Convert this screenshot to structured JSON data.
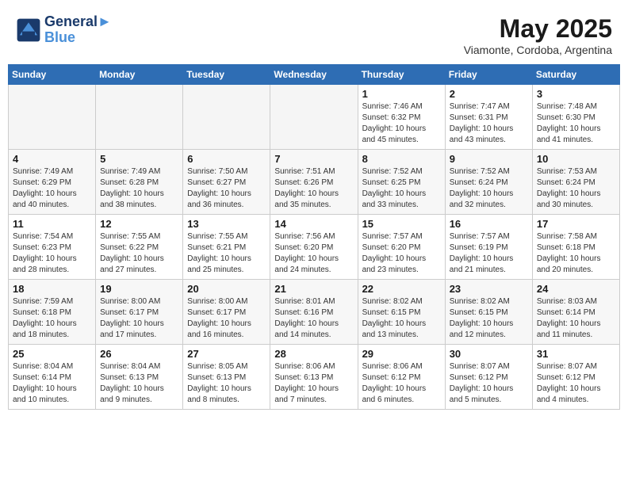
{
  "header": {
    "logo_line1": "General",
    "logo_line2": "Blue",
    "month_year": "May 2025",
    "location": "Viamonte, Cordoba, Argentina"
  },
  "weekdays": [
    "Sunday",
    "Monday",
    "Tuesday",
    "Wednesday",
    "Thursday",
    "Friday",
    "Saturday"
  ],
  "weeks": [
    [
      {
        "day": "",
        "info": ""
      },
      {
        "day": "",
        "info": ""
      },
      {
        "day": "",
        "info": ""
      },
      {
        "day": "",
        "info": ""
      },
      {
        "day": "1",
        "info": "Sunrise: 7:46 AM\nSunset: 6:32 PM\nDaylight: 10 hours\nand 45 minutes."
      },
      {
        "day": "2",
        "info": "Sunrise: 7:47 AM\nSunset: 6:31 PM\nDaylight: 10 hours\nand 43 minutes."
      },
      {
        "day": "3",
        "info": "Sunrise: 7:48 AM\nSunset: 6:30 PM\nDaylight: 10 hours\nand 41 minutes."
      }
    ],
    [
      {
        "day": "4",
        "info": "Sunrise: 7:49 AM\nSunset: 6:29 PM\nDaylight: 10 hours\nand 40 minutes."
      },
      {
        "day": "5",
        "info": "Sunrise: 7:49 AM\nSunset: 6:28 PM\nDaylight: 10 hours\nand 38 minutes."
      },
      {
        "day": "6",
        "info": "Sunrise: 7:50 AM\nSunset: 6:27 PM\nDaylight: 10 hours\nand 36 minutes."
      },
      {
        "day": "7",
        "info": "Sunrise: 7:51 AM\nSunset: 6:26 PM\nDaylight: 10 hours\nand 35 minutes."
      },
      {
        "day": "8",
        "info": "Sunrise: 7:52 AM\nSunset: 6:25 PM\nDaylight: 10 hours\nand 33 minutes."
      },
      {
        "day": "9",
        "info": "Sunrise: 7:52 AM\nSunset: 6:24 PM\nDaylight: 10 hours\nand 32 minutes."
      },
      {
        "day": "10",
        "info": "Sunrise: 7:53 AM\nSunset: 6:24 PM\nDaylight: 10 hours\nand 30 minutes."
      }
    ],
    [
      {
        "day": "11",
        "info": "Sunrise: 7:54 AM\nSunset: 6:23 PM\nDaylight: 10 hours\nand 28 minutes."
      },
      {
        "day": "12",
        "info": "Sunrise: 7:55 AM\nSunset: 6:22 PM\nDaylight: 10 hours\nand 27 minutes."
      },
      {
        "day": "13",
        "info": "Sunrise: 7:55 AM\nSunset: 6:21 PM\nDaylight: 10 hours\nand 25 minutes."
      },
      {
        "day": "14",
        "info": "Sunrise: 7:56 AM\nSunset: 6:20 PM\nDaylight: 10 hours\nand 24 minutes."
      },
      {
        "day": "15",
        "info": "Sunrise: 7:57 AM\nSunset: 6:20 PM\nDaylight: 10 hours\nand 23 minutes."
      },
      {
        "day": "16",
        "info": "Sunrise: 7:57 AM\nSunset: 6:19 PM\nDaylight: 10 hours\nand 21 minutes."
      },
      {
        "day": "17",
        "info": "Sunrise: 7:58 AM\nSunset: 6:18 PM\nDaylight: 10 hours\nand 20 minutes."
      }
    ],
    [
      {
        "day": "18",
        "info": "Sunrise: 7:59 AM\nSunset: 6:18 PM\nDaylight: 10 hours\nand 18 minutes."
      },
      {
        "day": "19",
        "info": "Sunrise: 8:00 AM\nSunset: 6:17 PM\nDaylight: 10 hours\nand 17 minutes."
      },
      {
        "day": "20",
        "info": "Sunrise: 8:00 AM\nSunset: 6:17 PM\nDaylight: 10 hours\nand 16 minutes."
      },
      {
        "day": "21",
        "info": "Sunrise: 8:01 AM\nSunset: 6:16 PM\nDaylight: 10 hours\nand 14 minutes."
      },
      {
        "day": "22",
        "info": "Sunrise: 8:02 AM\nSunset: 6:15 PM\nDaylight: 10 hours\nand 13 minutes."
      },
      {
        "day": "23",
        "info": "Sunrise: 8:02 AM\nSunset: 6:15 PM\nDaylight: 10 hours\nand 12 minutes."
      },
      {
        "day": "24",
        "info": "Sunrise: 8:03 AM\nSunset: 6:14 PM\nDaylight: 10 hours\nand 11 minutes."
      }
    ],
    [
      {
        "day": "25",
        "info": "Sunrise: 8:04 AM\nSunset: 6:14 PM\nDaylight: 10 hours\nand 10 minutes."
      },
      {
        "day": "26",
        "info": "Sunrise: 8:04 AM\nSunset: 6:13 PM\nDaylight: 10 hours\nand 9 minutes."
      },
      {
        "day": "27",
        "info": "Sunrise: 8:05 AM\nSunset: 6:13 PM\nDaylight: 10 hours\nand 8 minutes."
      },
      {
        "day": "28",
        "info": "Sunrise: 8:06 AM\nSunset: 6:13 PM\nDaylight: 10 hours\nand 7 minutes."
      },
      {
        "day": "29",
        "info": "Sunrise: 8:06 AM\nSunset: 6:12 PM\nDaylight: 10 hours\nand 6 minutes."
      },
      {
        "day": "30",
        "info": "Sunrise: 8:07 AM\nSunset: 6:12 PM\nDaylight: 10 hours\nand 5 minutes."
      },
      {
        "day": "31",
        "info": "Sunrise: 8:07 AM\nSunset: 6:12 PM\nDaylight: 10 hours\nand 4 minutes."
      }
    ]
  ]
}
